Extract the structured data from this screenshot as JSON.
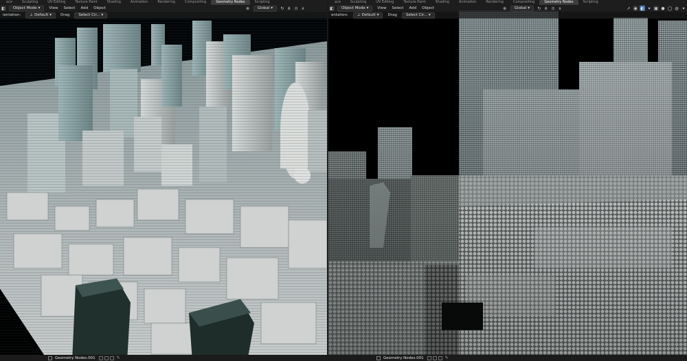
{
  "left": {
    "workspace_tabs": [
      "ace",
      "Sculpting",
      "UV Editing",
      "Texture Paint",
      "Shading",
      "Animation",
      "Rendering",
      "Compositing",
      "Geometry Nodes",
      "Scripting"
    ],
    "active_workspace": "Geometry Nodes",
    "header": {
      "transform": "Global",
      "mode": "Object Mode",
      "menus": [
        "View",
        "Select",
        "Add",
        "Object"
      ]
    },
    "toolbar": {
      "orientation_label": "ientation:",
      "orientation_value": "Default",
      "drag_label": "Drag",
      "drag_value": "Select Cir..."
    },
    "footer": {
      "node_tree": "Geometry Nodes.001"
    }
  },
  "right": {
    "workspace_tabs": [
      "ace",
      "Sculpting",
      "UV Editing",
      "Texture Paint",
      "Shading",
      "Animation",
      "Rendering",
      "Compositing",
      "Geometry Nodes",
      "Scripting"
    ],
    "active_workspace": "Geometry Nodes",
    "header": {
      "transform": "Global",
      "mode": "Object Mode",
      "menus": [
        "View",
        "Select",
        "Add",
        "Object"
      ]
    },
    "toolbar": {
      "orientation_label": "entation:",
      "orientation_value": "Default",
      "drag_label": "Drag",
      "drag_value": "Select Cir..."
    },
    "footer": {
      "node_tree": "Geometry Nodes.001"
    }
  },
  "colors": {
    "ui_bg": "#1d1d1d",
    "header_bg": "#202020",
    "active_tab": "#3d3d3d",
    "accent": "#4772b3"
  },
  "icons": [
    "cursor-icon",
    "viewport-shading-icon",
    "snap-icon",
    "proportional-icon",
    "overlay-icon",
    "xray-icon",
    "mode-icon",
    "pin-icon"
  ]
}
